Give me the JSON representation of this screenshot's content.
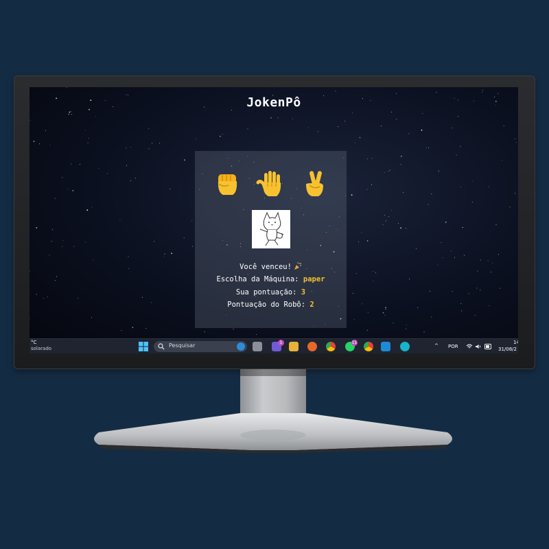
{
  "game": {
    "title": "JokenPô",
    "choices": [
      {
        "name": "rock",
        "icon": "raised-fist-emoji"
      },
      {
        "name": "paper",
        "icon": "raised-hand-emoji"
      },
      {
        "name": "scissors",
        "icon": "victory-hand-emoji"
      }
    ],
    "machine_image_icon": "cat-dancing-sketch",
    "result_text": "Você venceu!",
    "result_icon": "party-popper-emoji",
    "machine_choice_label": "Escolha da Máquina:",
    "machine_choice_value": "paper",
    "user_score_label": "Sua pontuação:",
    "user_score_value": "3",
    "robot_score_label": "Pontuação do Robô:",
    "robot_score_value": "2"
  },
  "taskbar": {
    "weather_temp": "°C",
    "weather_desc": "solarado",
    "search_placeholder": "Pesquisar",
    "teams_badge": "1",
    "whatsapp_badge": "11",
    "language": "POR",
    "time": "14",
    "date": "31/08/2"
  },
  "colors": {
    "background": "#142c43",
    "highlight": "#f2c230",
    "taskbar": "#1f2430"
  }
}
